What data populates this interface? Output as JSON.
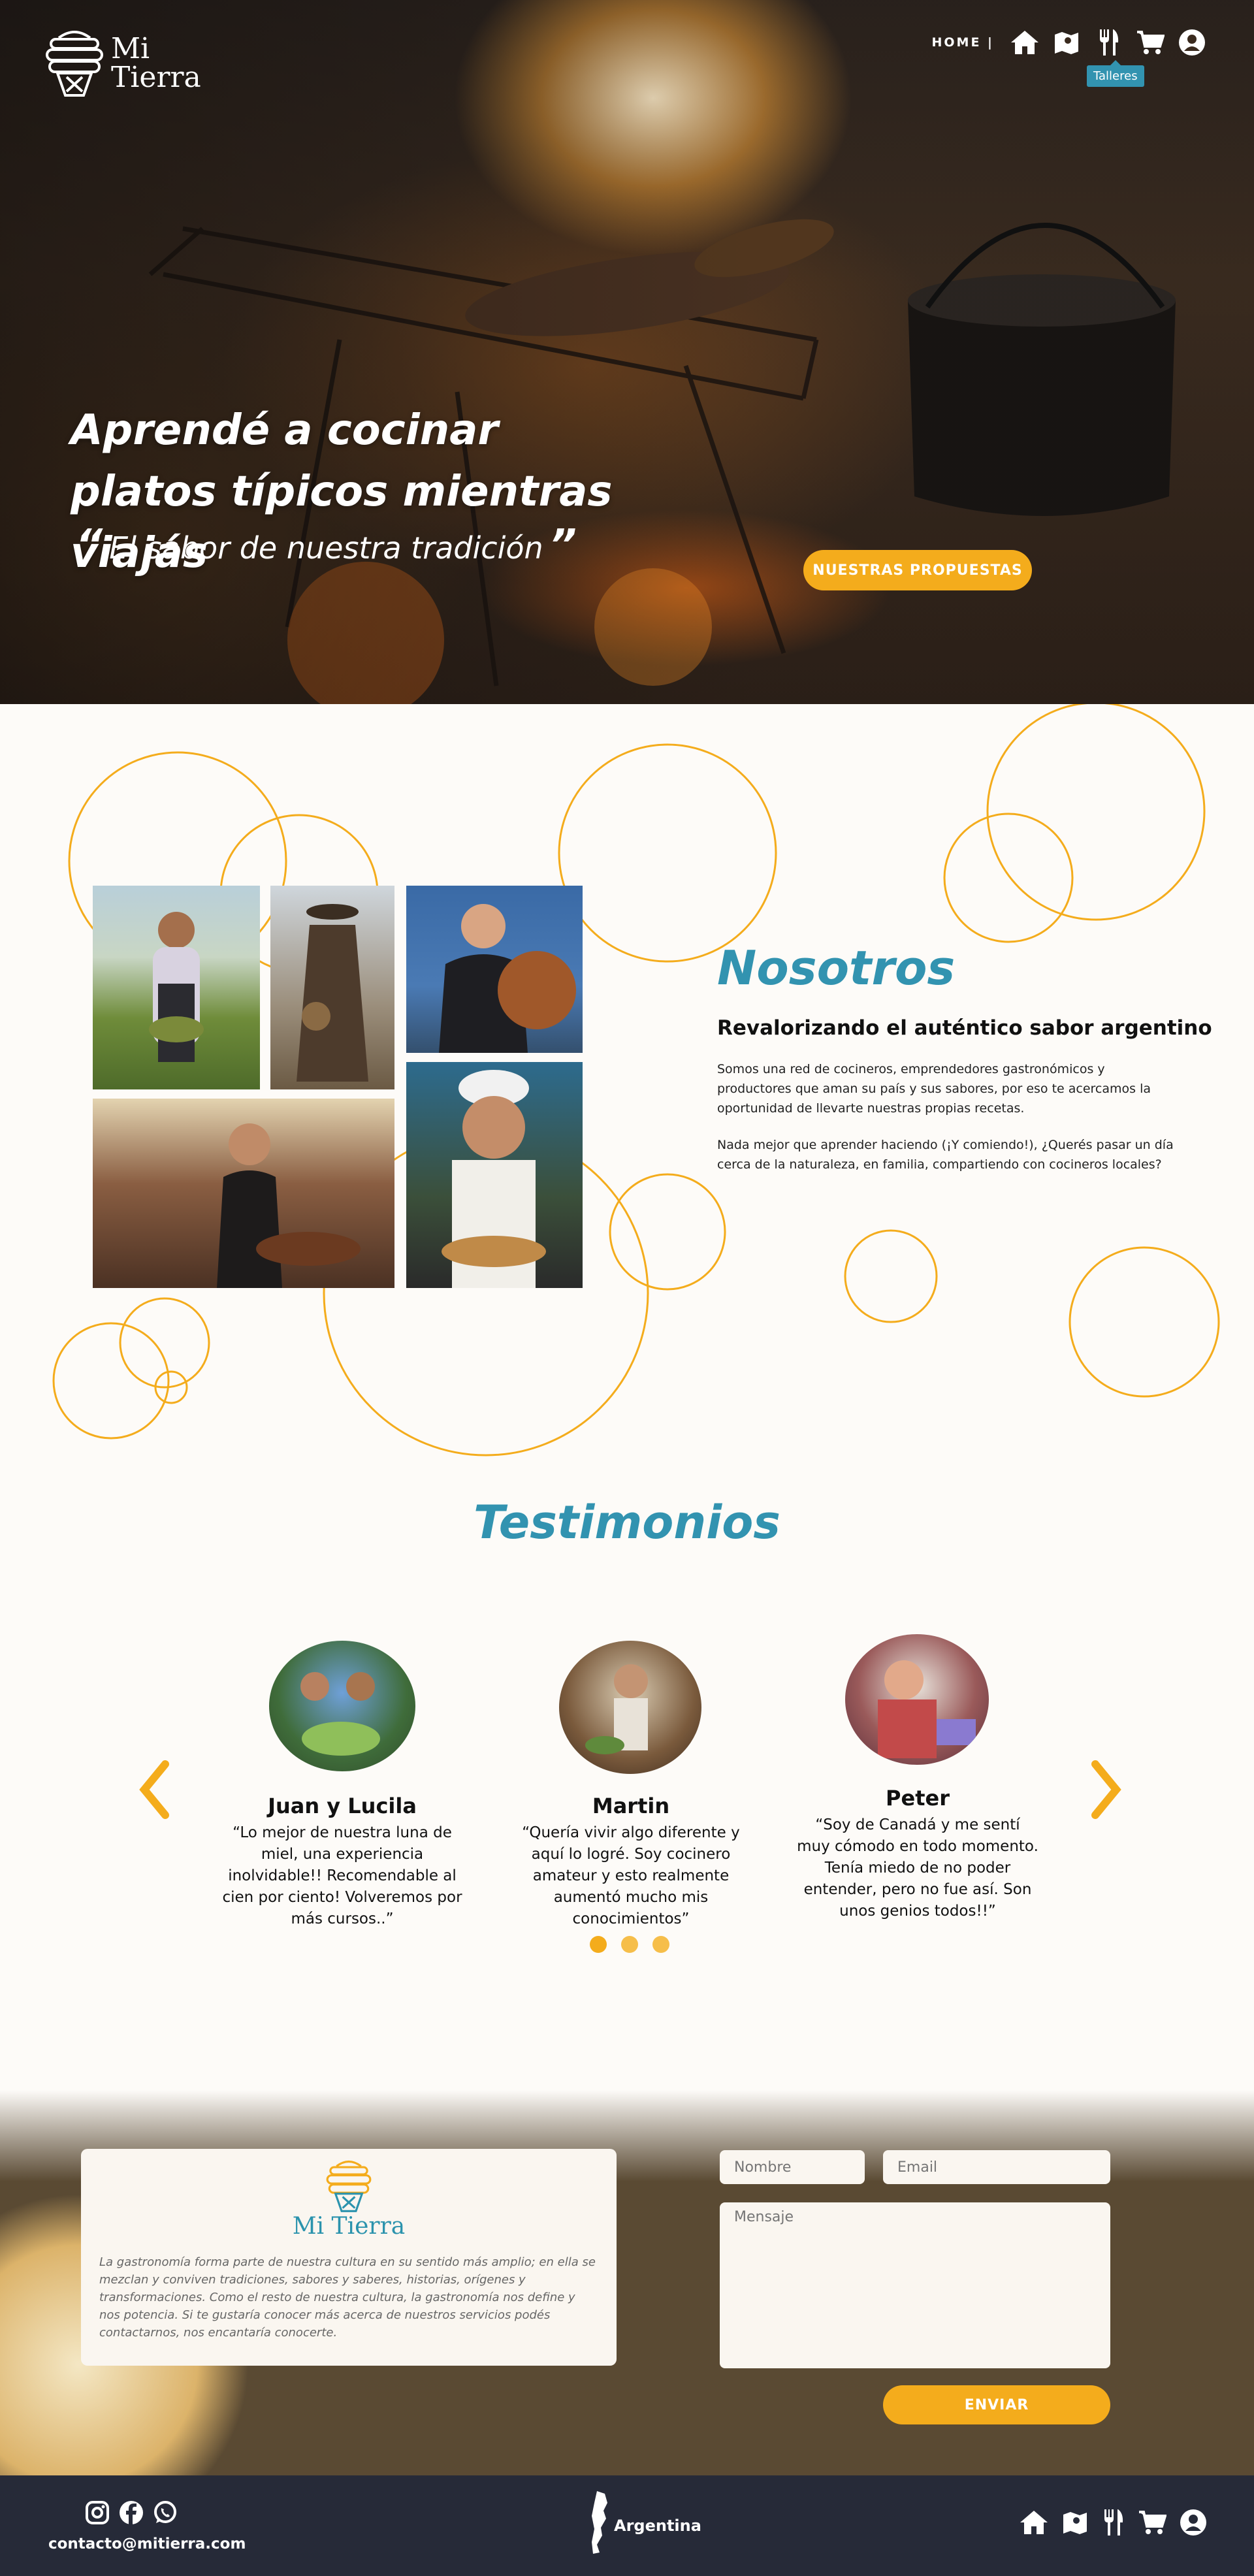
{
  "header": {
    "brand_line1": "Mi",
    "brand_line2": "Tierra",
    "nav_home": "HOME |",
    "nav_icons": [
      "home-icon",
      "map-icon",
      "fork-knife-icon",
      "cart-icon",
      "user-icon"
    ],
    "tooltip": "Talleres"
  },
  "hero": {
    "title": "Aprendé a cocinar platos típicos mientras viajás",
    "quote_open": "“",
    "quote": "El sabor de nuestra tradición",
    "quote_close": "”",
    "cta": "NUESTRAS PROPUESTAS"
  },
  "about": {
    "title": "Nosotros",
    "subtitle": "Revalorizando el auténtico sabor argentino",
    "p1": "Somos una red de cocineros, emprendedores gastronómicos y productores que aman su país y sus sabores, por eso te acercamos la oportunidad de llevarte nuestras propias recetas.",
    "p2": "Nada mejor que aprender haciendo (¡Y comiendo!), ¿Querés pasar un día cerca de la naturaleza, en familia, compartiendo con cocineros locales?"
  },
  "testimonials": {
    "title": "Testimonios",
    "items": [
      {
        "name": "Juan y Lucila",
        "text": "“Lo mejor de nuestra luna de miel, una experiencia inolvidable!! Recomendable al cien por ciento! Volveremos por más cursos..”"
      },
      {
        "name": "Martin",
        "text": "“Quería vivir algo diferente y aquí lo logré. Soy cocinero amateur y esto realmente aumentó mucho mis conocimientos”"
      },
      {
        "name": "Peter",
        "text": "“Soy de Canadá y me sentí muy cómodo en todo momento. Tenía miedo de no poder entender, pero no fue así. Son unos genios todos!!”"
      }
    ],
    "dots": 3
  },
  "contact": {
    "brand": "Mi Tierra",
    "text": "La gastronomía forma parte de nuestra cultura en su sentido más amplio; en ella se mezclan y conviven tradiciones, sabores y saberes, historias, orígenes y transformaciones. Como el resto de nuestra cultura, la gastronomía nos define y nos potencia. Si te gustaría conocer más acerca de nuestros servicios podés contactarnos, nos encantaría conocerte.",
    "name_placeholder": "Nombre",
    "email_placeholder": "Email",
    "message_placeholder": "Mensaje",
    "send": "ENVIAR"
  },
  "footer": {
    "email": "contacto@mitierra.com",
    "country": "Argentina",
    "social": [
      "instagram-icon",
      "facebook-icon",
      "whatsapp-icon"
    ]
  },
  "colors": {
    "accent": "#f4ac1c",
    "brand_blue": "#3293b0",
    "footer_bg": "#262a38"
  }
}
